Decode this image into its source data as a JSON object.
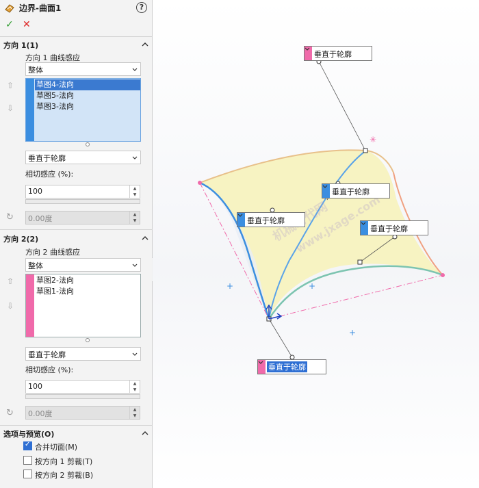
{
  "header": {
    "title": "边界-曲面1",
    "help": "?"
  },
  "actions": {
    "ok": "✓",
    "cancel": "✕"
  },
  "dir1": {
    "title": "方向 1(1)",
    "curve_label": "方向 1 曲线感应",
    "curve_value": "整体",
    "items": [
      "草图4-法向",
      "草图5-法向",
      "草图3-法向"
    ],
    "constraint": "垂直于轮廓",
    "tangent_label": "相切感应 (%):",
    "tangent_value": "100",
    "angle_value": "0.00度"
  },
  "dir2": {
    "title": "方向 2(2)",
    "curve_label": "方向 2 曲线感应",
    "curve_value": "整体",
    "items": [
      "草图2-法向",
      "草图1-法向"
    ],
    "constraint": "垂直于轮廓",
    "tangent_label": "相切感应 (%):",
    "tangent_value": "100",
    "angle_value": "0.00度"
  },
  "options": {
    "title": "选项与预览(O)",
    "merge": "合并切面(M)",
    "trim1": "按方向 1 剪裁(T)",
    "trim2": "按方向 2 剪裁(B)",
    "merge_checked": true,
    "trim1_checked": false,
    "trim2_checked": false
  },
  "callouts": {
    "top": "垂直于轮廓",
    "mid_right": "垂直于轮廓",
    "left": "垂直于轮廓",
    "right": "垂直于轮廓",
    "bottom": "垂直于轮廓"
  },
  "watermark": {
    "line1": "机械时代网",
    "line2": "www.jxage.com"
  },
  "colors": {
    "pink": "#f06aaa",
    "blue": "#3b8ee0",
    "selection": "#2f6fd3",
    "surface": "#f7f3c2"
  }
}
